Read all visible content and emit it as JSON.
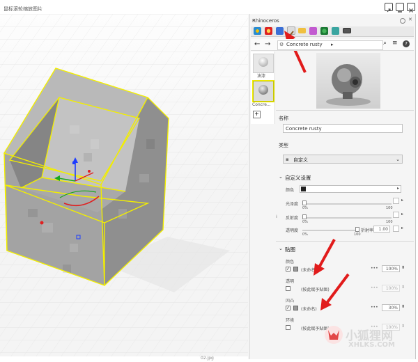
{
  "window": {
    "title": "鼠标滚轮缩放图片",
    "footer": "02.jpg"
  },
  "panel": {
    "title": "Rhinoceros"
  },
  "material": {
    "breadcrumb": "Concrete rusty",
    "thumb1_label": "油漆",
    "thumb2_label": "Concre..."
  },
  "name_section": {
    "label": "名称",
    "value": "Concrete rusty"
  },
  "type_section": {
    "label": "类型",
    "value": "自定义"
  },
  "custom_section": {
    "title": "自定义设置",
    "color_label": "颜色",
    "gloss_label": "光泽度",
    "reflect_label": "反射度",
    "transp_label": "透明度",
    "ior_label": "折射率",
    "ior_value": "1.00",
    "scale_min": "0%",
    "scale_max": "100",
    "gloss_level": 0.0,
    "reflect_level": 0.0,
    "transp_level": 0.92
  },
  "maps_section": {
    "title": "贴图",
    "rows": [
      {
        "name": "颜色",
        "checked": true,
        "texture": "(未命名)",
        "amount": "100%",
        "enabled": true
      },
      {
        "name": "透明",
        "checked": false,
        "texture": "(按此赋予贴图)",
        "amount": "100%",
        "enabled": false
      },
      {
        "name": "凹凸",
        "checked": true,
        "texture": "(未命名)",
        "amount": "30%",
        "enabled": true
      },
      {
        "name": "环境",
        "checked": false,
        "texture": "(按此赋予贴图)",
        "amount": "100%",
        "enabled": false
      }
    ]
  },
  "watermark": {
    "brand": "小狐狸网",
    "domain": "XHLKS.COM"
  },
  "colors": {
    "accent": "#1e6fd0",
    "arrow": "#e11b1b",
    "highlight": "#f2ee00",
    "panel_bg": "#f5f5f5"
  }
}
